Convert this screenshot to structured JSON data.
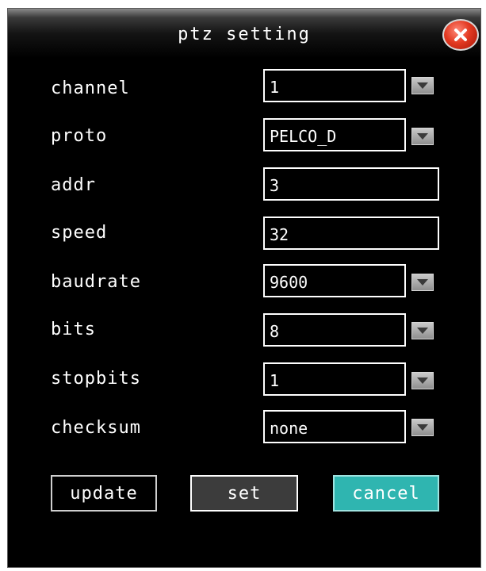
{
  "dialog": {
    "title": "ptz setting",
    "close_icon": "close-icon"
  },
  "fields": [
    {
      "label": "channel",
      "value": "1",
      "type": "dropdown"
    },
    {
      "label": "proto",
      "value": "PELCO_D",
      "type": "dropdown"
    },
    {
      "label": "addr",
      "value": "3",
      "type": "text"
    },
    {
      "label": "speed",
      "value": "32",
      "type": "text"
    },
    {
      "label": "baudrate",
      "value": "9600",
      "type": "dropdown"
    },
    {
      "label": "bits",
      "value": "8",
      "type": "dropdown"
    },
    {
      "label": "stopbits",
      "value": "1",
      "type": "dropdown"
    },
    {
      "label": "checksum",
      "value": "none",
      "type": "dropdown"
    }
  ],
  "buttons": {
    "update": "update",
    "set": "set",
    "cancel": "cancel"
  },
  "colors": {
    "background": "#000000",
    "text": "#ffffff",
    "cancel_accent": "#2fb5b0",
    "close_red": "#e33a22"
  }
}
